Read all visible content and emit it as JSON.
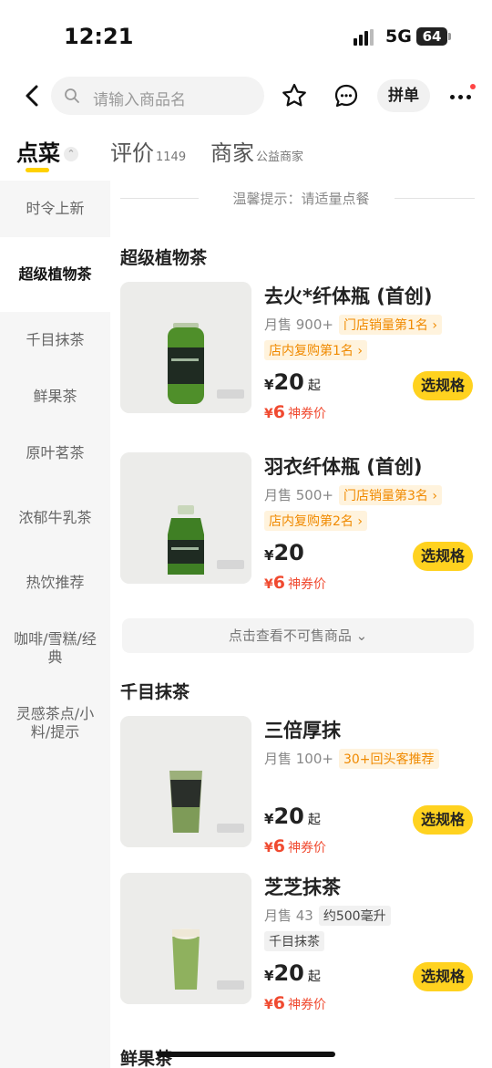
{
  "status_bar": {
    "time": "12:21",
    "network": "5G",
    "battery": "64"
  },
  "nav": {
    "search_placeholder": "请输入商品名",
    "group_buy": "拼单"
  },
  "tabs": [
    {
      "label": "点菜",
      "sub": ""
    },
    {
      "label": "评价",
      "sub": "1149"
    },
    {
      "label": "商家",
      "sub": "公益商家"
    }
  ],
  "sidebar": {
    "categories": [
      "时令上新",
      "超级植物茶",
      "千目抹茶",
      "鲜果茶",
      "原叶茗茶",
      "浓郁牛乳茶",
      "热饮推荐",
      "咖啡/雪糕/经典",
      "灵感茶点/小料/提示"
    ],
    "active": "超级植物茶"
  },
  "tip": "温馨提示：请适量点餐",
  "unavailable_label": "点击查看不可售商品",
  "sections": [
    {
      "title": "超级植物茶",
      "items": [
        {
          "name": "去火*纤体瓶 (首创)",
          "sold": "月售 900+",
          "tag1": "门店销量第1名 ›",
          "tag2": "店内复购第1名 ›",
          "currency": "¥",
          "price": "20",
          "price_suffix": "起",
          "coupon_price": "6",
          "coupon_label": "神券价",
          "button": "选规格"
        },
        {
          "name": "羽衣纤体瓶 (首创)",
          "sold": "月售 500+",
          "tag1": "门店销量第3名 ›",
          "tag2": "店内复购第2名 ›",
          "currency": "¥",
          "price": "20",
          "price_suffix": "",
          "coupon_price": "6",
          "coupon_label": "神券价",
          "button": "选规格"
        }
      ]
    },
    {
      "title": "千目抹茶",
      "items": [
        {
          "name": "三倍厚抹",
          "sold": "月售 100+",
          "tag1": "30+回头客推荐",
          "currency": "¥",
          "price": "20",
          "price_suffix": "起",
          "coupon_price": "6",
          "coupon_label": "神券价",
          "button": "选规格"
        },
        {
          "name": "芝芝抹茶",
          "sold": "月售 43",
          "tag1": "约500毫升",
          "tag2": "千目抹茶",
          "currency": "¥",
          "price": "20",
          "price_suffix": "起",
          "coupon_price": "6",
          "coupon_label": "神券价",
          "button": "选规格"
        }
      ]
    },
    {
      "title": "鲜果茶"
    }
  ],
  "colors": {
    "accent": "#ffd21f",
    "coupon": "#f04a30",
    "tag": "#f08a00"
  }
}
